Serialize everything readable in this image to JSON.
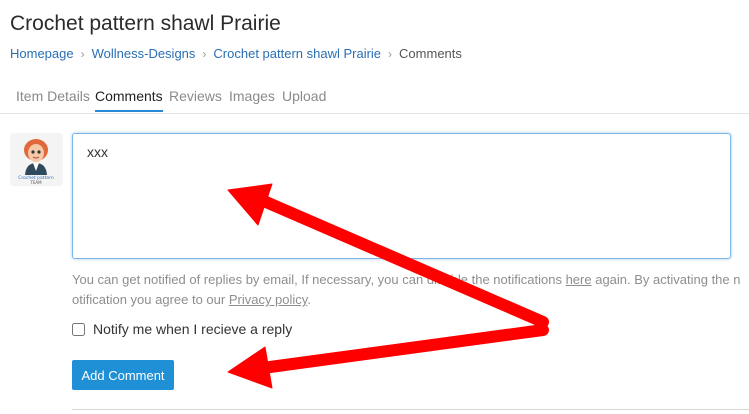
{
  "page": {
    "title": "Crochet pattern shawl Prairie"
  },
  "breadcrumb": {
    "items": [
      {
        "label": "Homepage"
      },
      {
        "label": "Wollness-Designs"
      },
      {
        "label": "Crochet pattern shawl Prairie"
      },
      {
        "label": "Comments"
      }
    ]
  },
  "tabs": [
    {
      "label": "Item Details",
      "active": false
    },
    {
      "label": "Comments",
      "active": true
    },
    {
      "label": "Reviews",
      "active": false
    },
    {
      "label": "Images",
      "active": false
    },
    {
      "label": "Upload",
      "active": false
    }
  ],
  "avatar": {
    "caption_line1": "Crochet pattern",
    "caption_line2": "TEAM"
  },
  "comment": {
    "value": "xxx"
  },
  "notice": {
    "part1": "You can get notified of replies by email, If necessary, you can disable the notifications ",
    "here_link": "here",
    "part2": " again. By activating the notification you agree to our ",
    "privacy_link": "Privacy policy",
    "part3": "."
  },
  "notify": {
    "label": "Notify me when I recieve a reply",
    "checked": false
  },
  "submit": {
    "label": "Add Comment"
  },
  "colors": {
    "accent": "#1f8fd6",
    "link": "#2a6fb5",
    "annotation_arrow": "#ff0000"
  }
}
